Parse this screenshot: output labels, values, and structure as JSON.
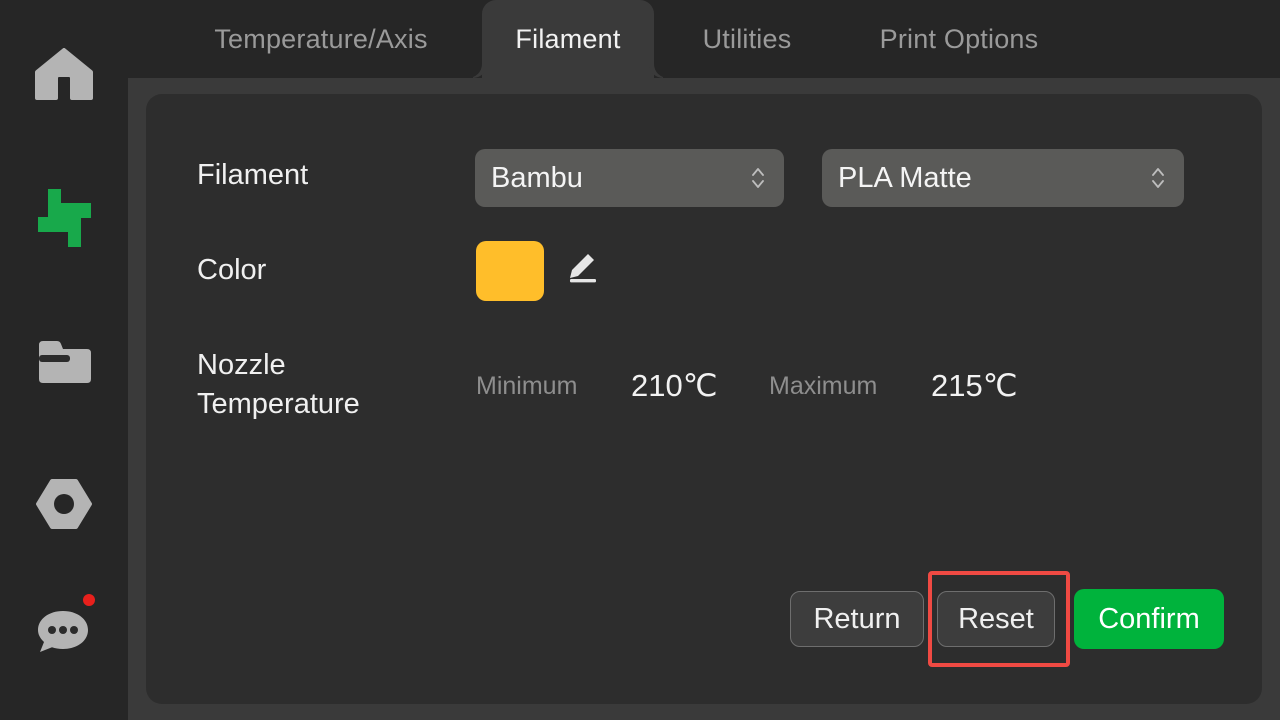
{
  "sidebar": {
    "items": [
      {
        "name": "home",
        "icon": "home-icon",
        "color": "#b4b4b4",
        "badge": false
      },
      {
        "name": "control",
        "icon": "sliders-icon",
        "color": "#18a94b",
        "badge": false
      },
      {
        "name": "files",
        "icon": "folder-icon",
        "color": "#b4b4b4",
        "badge": false
      },
      {
        "name": "settings",
        "icon": "nut-icon",
        "color": "#b4b4b4",
        "badge": false
      },
      {
        "name": "messages",
        "icon": "chat-icon",
        "color": "#b4b4b4",
        "badge": true
      }
    ],
    "badge_color": "#e8201c"
  },
  "tabs": [
    {
      "label": "Temperature/Axis",
      "active": false
    },
    {
      "label": "Filament",
      "active": true
    },
    {
      "label": "Utilities",
      "active": false
    },
    {
      "label": "Print Options",
      "active": false
    }
  ],
  "form": {
    "filament": {
      "label": "Filament",
      "brand_value": "Bambu",
      "type_value": "PLA Matte"
    },
    "color": {
      "label": "Color",
      "swatch_hex": "#FFBE2A",
      "edit_icon": "pencil-icon"
    },
    "nozzle_temperature": {
      "label": "Nozzle\nTemperature",
      "minimum_caption": "Minimum",
      "minimum_value": "210℃",
      "maximum_caption": "Maximum",
      "maximum_value": "215℃"
    }
  },
  "actions": {
    "return_label": "Return",
    "reset_label": "Reset",
    "confirm_label": "Confirm",
    "confirm_color": "#00b33c",
    "highlight_color": "#f04a43",
    "highlighted_button": "Reset"
  }
}
